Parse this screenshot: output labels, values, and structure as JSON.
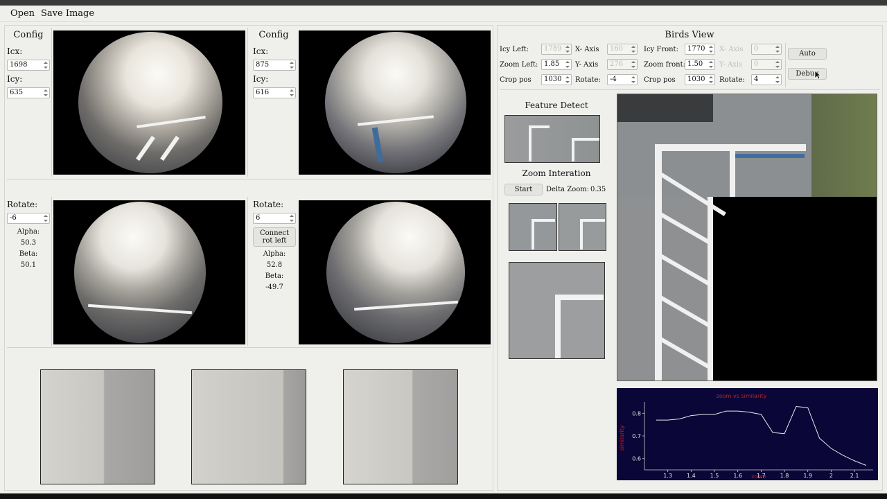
{
  "menu": {
    "open": "Open",
    "save_image": "Save Image"
  },
  "left_top_config": {
    "title": "Config",
    "icx_label": "Icx:",
    "icx_value": "1698",
    "icy_label": "Icy:",
    "icy_value": "635"
  },
  "right_top_config": {
    "title": "Config",
    "icx_label": "Icx:",
    "icx_value": "875",
    "icy_label": "Icy:",
    "icy_value": "616"
  },
  "left_rotate": {
    "label": "Rotate:",
    "value": "-6",
    "alpha_label": "Alpha:",
    "alpha_value": "50.3",
    "beta_label": "Beta:",
    "beta_value": "50.1"
  },
  "right_rotate": {
    "label": "Rotate:",
    "value": "6",
    "connect_button": "Connect\nrot left",
    "alpha_label": "Alpha:",
    "alpha_value": "52.8",
    "beta_label": "Beta:",
    "beta_value": "-49.7"
  },
  "birds_view": {
    "title": "Birds View",
    "icy_left_label": "Icy Left:",
    "icy_left_value": "1789",
    "x_axis_left_label": "X- Axis",
    "x_axis_left_value": "160",
    "zoom_left_label": "Zoom Left:",
    "zoom_left_value": "1.85",
    "y_axis_left_label": "Y- Axis",
    "y_axis_left_value": "276",
    "crop_pos_left_label": "Crop pos",
    "crop_pos_left_value": "1030",
    "rotate_left_label": "Rotate:",
    "rotate_left_value": "-4",
    "icy_front_label": "Icy Front:",
    "icy_front_value": "1770",
    "x_axis_front_label": "X- Axis",
    "x_axis_front_value": "0",
    "zoom_front_label": "Zoom front:",
    "zoom_front_value": "1.50",
    "y_axis_front_label": "Y- Axis",
    "y_axis_front_value": "0",
    "crop_pos_front_label": "Crop pos",
    "crop_pos_front_value": "1030",
    "rotate_front_label": "Rotate:",
    "rotate_front_value": "4",
    "auto_button": "Auto",
    "debug_button": "Debug"
  },
  "feature_detect": {
    "title": "Feature Detect"
  },
  "zoom_iteration": {
    "title": "Zoom Interation",
    "start_button": "Start",
    "delta_label": "Delta Zoom:",
    "delta_value": "0.35"
  },
  "colors": {
    "plot_bg": "#0a0638",
    "plot_line": "#e8e8e8",
    "plot_label": "#c81e1e"
  },
  "chart_data": {
    "type": "line",
    "title": "zoom vs similarity",
    "xlabel": "zoom",
    "ylabel": "similarity",
    "x": [
      1.25,
      1.3,
      1.35,
      1.4,
      1.45,
      1.5,
      1.55,
      1.6,
      1.65,
      1.7,
      1.75,
      1.8,
      1.85,
      1.9,
      1.95,
      2.0,
      2.05,
      2.1,
      2.15
    ],
    "y": [
      0.77,
      0.77,
      0.775,
      0.79,
      0.795,
      0.795,
      0.81,
      0.81,
      0.805,
      0.795,
      0.715,
      0.71,
      0.83,
      0.825,
      0.69,
      0.645,
      0.615,
      0.59,
      0.57
    ],
    "xticks": [
      "1.3",
      "1.4",
      "1.5",
      "1.6",
      "1.7",
      "1.8",
      "1.9",
      "2",
      "2.1"
    ],
    "yticks": [
      "0.6",
      "0.7",
      "0.8"
    ],
    "xlim": [
      1.2,
      2.18
    ],
    "ylim": [
      0.55,
      0.85
    ],
    "grid": false
  }
}
